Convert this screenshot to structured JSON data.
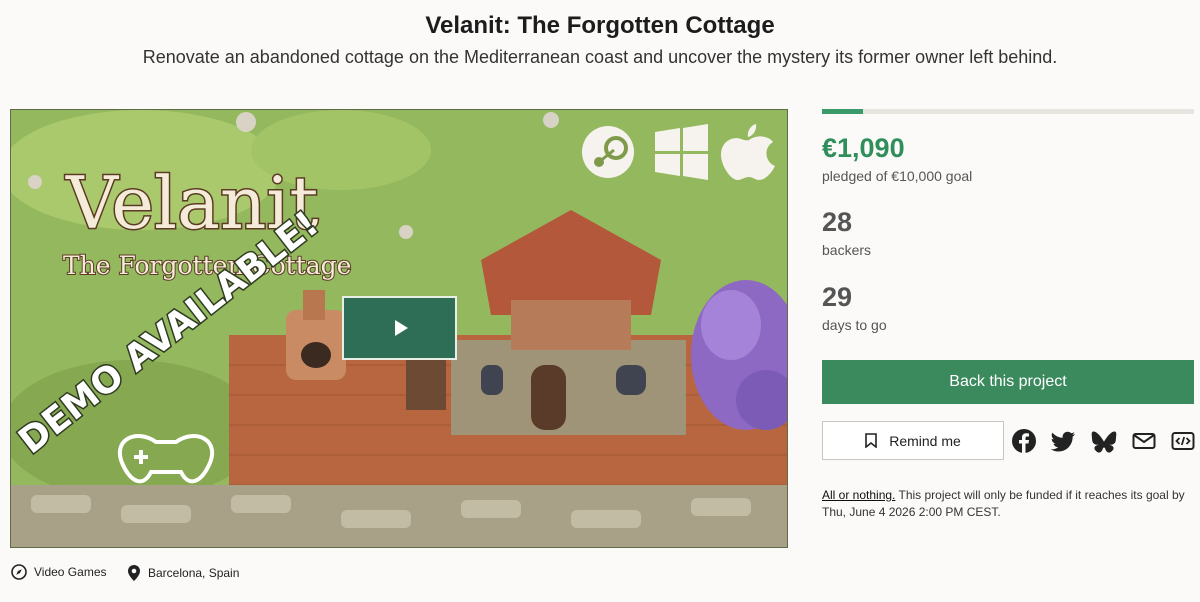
{
  "header": {
    "title": "Velanit: The Forgotten Cottage",
    "subtitle": "Renovate an abandoned cottage on the Mediterranean coast and uncover the mystery its former owner left behind."
  },
  "media": {
    "logo_title": "Velanit",
    "logo_subtitle": "The Forgotten Cottage",
    "badge_text": "DEMO AVAILABLE!",
    "platform_icons": [
      "steam-icon",
      "windows-icon",
      "apple-icon"
    ],
    "play_icon": "play-icon"
  },
  "funding": {
    "progress_fraction": 0.109,
    "pledged": "€1,090",
    "pledged_label": "pledged of €10,000 goal",
    "backers": "28",
    "backers_label": "backers",
    "days": "29",
    "days_label": "days to go",
    "accent_color": "#3b8a5d"
  },
  "actions": {
    "back_label": "Back this project",
    "remind_label": "Remind me",
    "share_icons": [
      "facebook-icon",
      "twitter-icon",
      "bluesky-icon",
      "mail-icon",
      "embed-icon"
    ]
  },
  "notice": {
    "bold": "All or nothing.",
    "text": " This project will only be funded if it reaches its goal by Thu, June 4 2026 2:00 PM CEST."
  },
  "meta": {
    "category": "Video Games",
    "location": "Barcelona, Spain"
  }
}
